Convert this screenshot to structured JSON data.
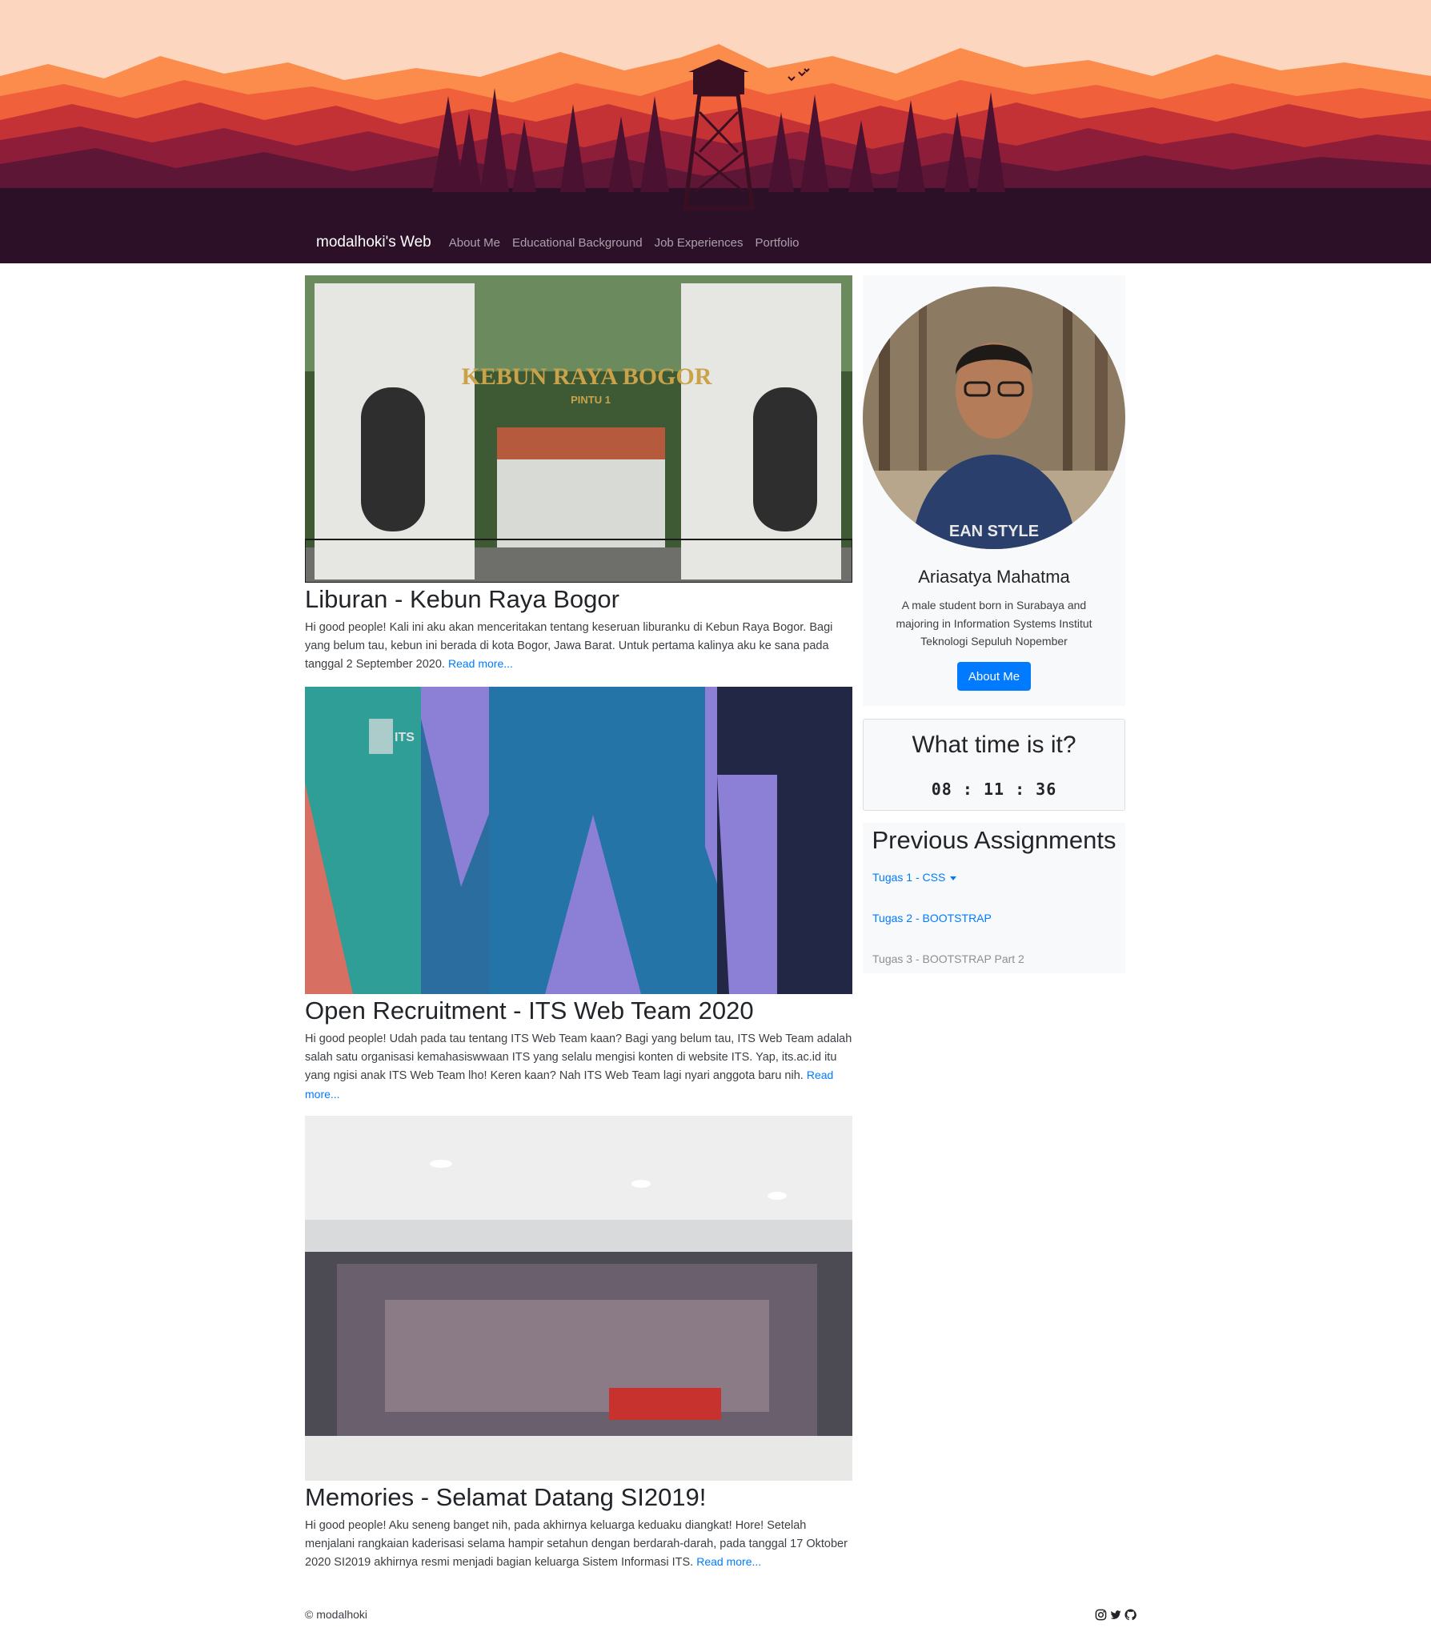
{
  "navbar": {
    "brand": "modalhoki's Web",
    "links": [
      "About Me",
      "Educational Background",
      "Job Experiences",
      "Portfolio"
    ]
  },
  "posts": [
    {
      "image_caption": "KEBUN RAYA BOGOR",
      "image_subcaption": "PINTU 1",
      "title": "Liburan - Kebun Raya Bogor",
      "body": "Hi good people! Kali ini aku akan menceritakan tentang keseruan liburanku di Kebun Raya Bogor. Bagi yang belum tau, kebun ini berada di kota Bogor, Jawa Barat. Untuk pertama kalinya aku ke sana pada tanggal 2 September 2020.",
      "read_more": "Read more..."
    },
    {
      "image_caption": "ITS",
      "title": "Open Recruitment - ITS Web Team 2020",
      "body": "Hi good people! Udah pada tau tentang ITS Web Team kaan? Bagi yang belum tau, ITS Web Team adalah salah satu organisasi kemahasiswwaan ITS yang selalu mengisi konten di website ITS. Yap, its.ac.id itu yang ngisi anak ITS Web Team lho! Keren kaan? Nah ITS Web Team lagi nyari anggota baru nih.",
      "read_more": "Read more..."
    },
    {
      "title": "Memories - Selamat Datang SI2019!",
      "body": "Hi good people! Aku seneng banget nih, pada akhirnya keluarga keduaku diangkat! Hore! Setelah menjalani rangkaian kaderisasi selama hampir setahun dengan berdarah-darah, pada tanggal 17 Oktober 2020 SI2019 akhirnya resmi menjadi bagian keluarga Sistem Informasi ITS.",
      "read_more": "Read more..."
    }
  ],
  "profile": {
    "name": "Ariasatya Mahatma",
    "description": "A male student born in Surabaya and majoring in Information Systems Institut Teknologi Sepuluh Nopember",
    "shirt_text": "EAN STYLE",
    "button": "About Me"
  },
  "clock": {
    "title": "What time is it?",
    "time": "08 : 11 : 36"
  },
  "assignments": {
    "title": "Previous Assignments",
    "items": [
      "Tugas 1 - CSS",
      "Tugas 2 - BOOTSTRAP",
      "Tugas 3 - BOOTSTRAP Part 2"
    ]
  },
  "footer": {
    "copyright": "© modalhoki",
    "icons": [
      "instagram-icon",
      "twitter-icon",
      "github-icon"
    ]
  },
  "colors": {
    "link": "#007bff",
    "button": "#007bff",
    "banner_dark": "#2b1028",
    "banner_sky": "#fcd6bf"
  }
}
